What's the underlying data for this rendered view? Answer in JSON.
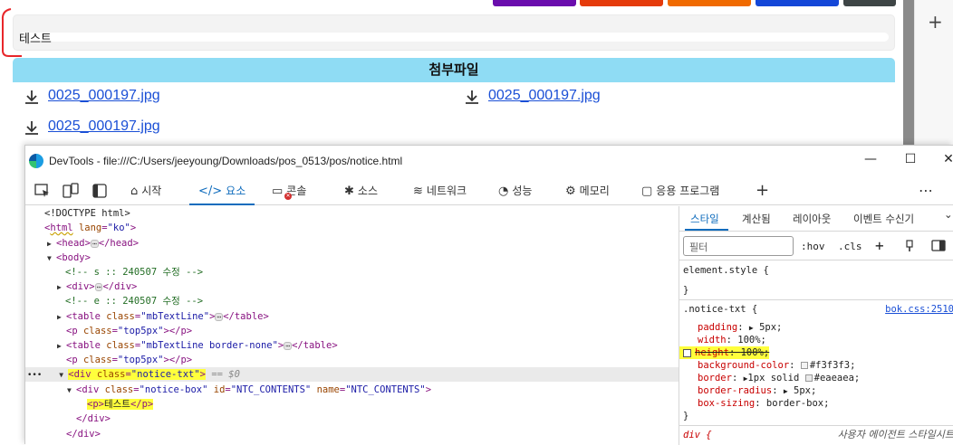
{
  "page": {
    "notice_text": "테스트",
    "attach_header": "첨부파일",
    "attachments": [
      "0025_000197.jpg",
      "0025_000197.jpg",
      "0025_000197.jpg"
    ],
    "top_buttons": [
      "#6a0dad",
      "#e53b0b",
      "#f06a00",
      "#1447d8",
      "#3e4546"
    ],
    "plus_label": "+"
  },
  "devtools": {
    "title": "DevTools - file:///C:/Users/jeeyoung/Downloads/pos_0513/pos/notice.html",
    "controls": {
      "minimize": "—",
      "maximize": "☐",
      "close": "✕"
    },
    "tabs": {
      "welcome": "시작",
      "elements": "요소",
      "console": "콘솔",
      "sources": "소스",
      "network": "네트워크",
      "performance": "성능",
      "memory": "메모리",
      "application": "응용 프로그램"
    },
    "add_tab": "+",
    "more": "⋯",
    "dom": {
      "doctype": "<!DOCTYPE html>",
      "html_tag": "html",
      "html_attr": "lang",
      "html_val": "\"ko\"",
      "head_open": "<head>",
      "head_close": "</head>",
      "body": "<body>",
      "comment1": "<!-- s :: 240507 수정 -->",
      "div_open": "<div>",
      "div_close": "</div>",
      "comment2": "<!-- e :: 240507 수정 -->",
      "table_tag": "table",
      "table_attr": "class",
      "table1_class": "\"mbTextLine\"",
      "table_close": "</table>",
      "p_tag": "p",
      "p_attr": "class",
      "p_class": "\"top5px\"",
      "p_close": "</p>",
      "table2_class": "\"mbTextLine border-none\"",
      "notice_div_tag": "div",
      "notice_div_attr": "class",
      "notice_div_class": "\"notice-txt\"",
      "eq0": "== $0",
      "box_tag": "div",
      "box_attr_class": "class",
      "box_class": "\"notice-box\"",
      "box_attr_id": "id",
      "box_id": "\"NTC_CONTENTS\"",
      "box_attr_name": "name",
      "box_name": "\"NTC_CONTENTS\"",
      "p_open": "<p>",
      "p_text": "테스트",
      "div_end": "</div>",
      "dots": "⋯",
      "row_menu": "•••"
    },
    "styles": {
      "tabs": [
        "스타일",
        "계산됨",
        "레이아웃",
        "이벤트 수신기"
      ],
      "chevron": "⌄",
      "filter_placeholder": "필터",
      "hov": ":hov",
      "cls": ".cls",
      "plus": "+",
      "element_style": "element.style {",
      "close_brace": "}",
      "rule_selector": ".notice-txt {",
      "source": "bok.css:2510",
      "props": [
        {
          "name": "padding",
          "value": "5px;",
          "arrow": true,
          "disabled": false
        },
        {
          "name": "width",
          "value": "100%;",
          "arrow": false,
          "disabled": false
        },
        {
          "name": "height",
          "value": "100%;",
          "arrow": false,
          "disabled": true
        },
        {
          "name": "background-color",
          "value": "#f3f3f3;",
          "swatch": "#f3f3f3"
        },
        {
          "name": "border",
          "value": "1px solid ",
          "arrow": true,
          "swatch": "#eaeaea",
          "value2": "#eaeaea;"
        },
        {
          "name": "border-radius",
          "value": "5px;",
          "arrow": true
        },
        {
          "name": "box-sizing",
          "value": "border-box;"
        }
      ],
      "div_rule": "div {",
      "ua_label": "사용자 에이전트 스타일시트"
    }
  }
}
